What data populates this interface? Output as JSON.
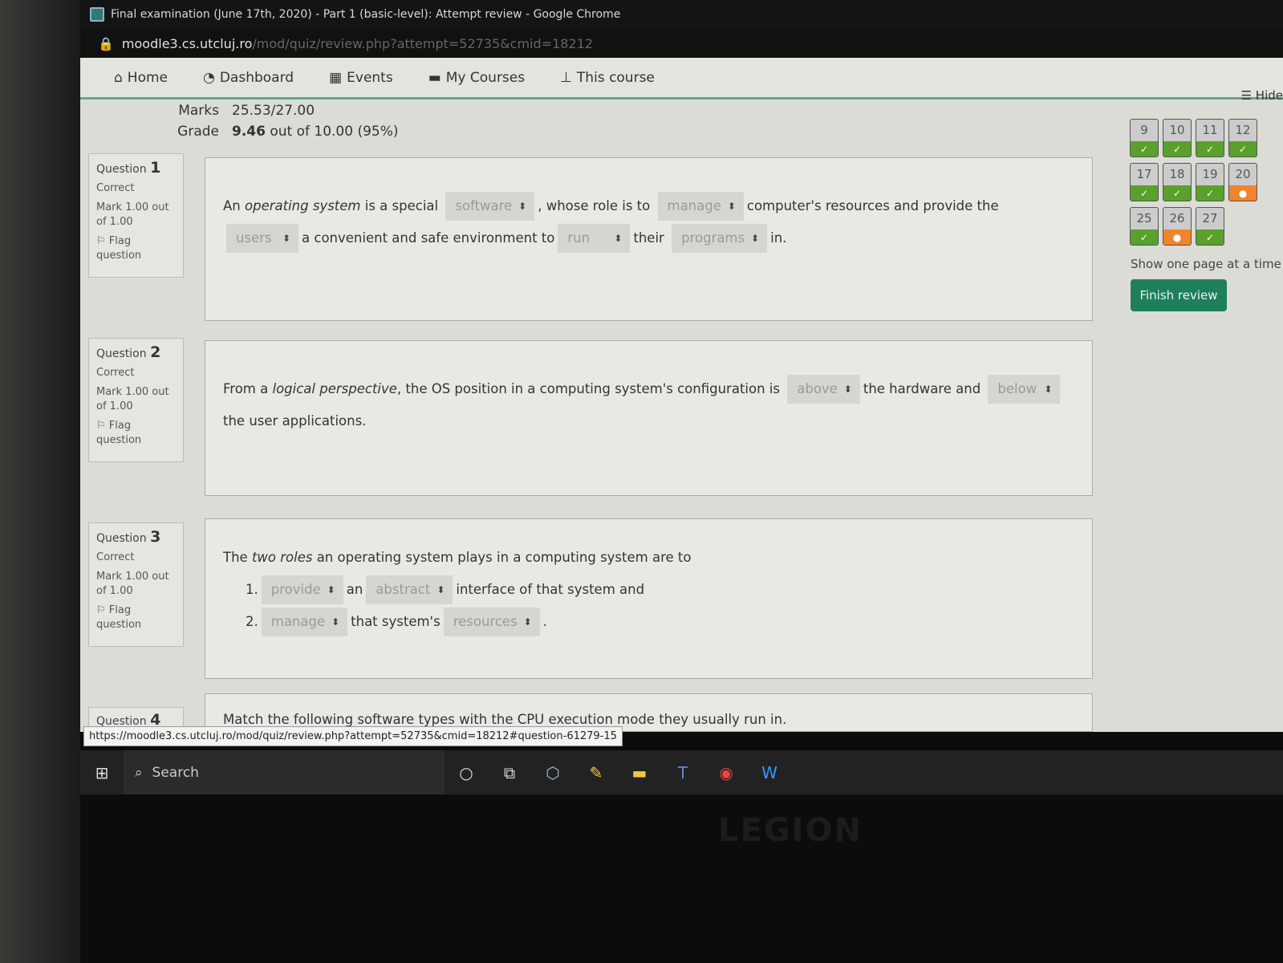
{
  "browser": {
    "title": "Final examination (June 17th, 2020) - Part 1 (basic-level): Attempt review - Google Chrome",
    "url_host": "moodle3.cs.utcluj.ro",
    "url_path": "/mod/quiz/review.php?attempt=52735&cmid=18212"
  },
  "nav": {
    "items": [
      {
        "label": "Home",
        "icon": "home-icon"
      },
      {
        "label": "Dashboard",
        "icon": "dashboard-icon"
      },
      {
        "label": "Events",
        "icon": "calendar-icon"
      },
      {
        "label": "My Courses",
        "icon": "briefcase-icon"
      },
      {
        "label": "This course",
        "icon": "sitemap-icon"
      }
    ],
    "hide": "Hide"
  },
  "summary": {
    "marks_label": "Marks",
    "marks": "25.53/27.00",
    "grade_label": "Grade",
    "grade_value": "9.46",
    "grade_rest": " out of 10.00 (95%)"
  },
  "questions": [
    {
      "label": "Question",
      "num": "1",
      "state": "Correct",
      "mark": "Mark 1.00 out of 1.00",
      "flag": "Flag question"
    },
    {
      "label": "Question",
      "num": "2",
      "state": "Correct",
      "mark": "Mark 1.00 out of 1.00",
      "flag": "Flag question"
    },
    {
      "label": "Question",
      "num": "3",
      "state": "Correct",
      "mark": "Mark 1.00 out of 1.00",
      "flag": "Flag question"
    },
    {
      "label": "Question",
      "num": "4"
    }
  ],
  "q1": {
    "t1": "An ",
    "t2": "operating system",
    "t3": " is a special",
    "s1": "software",
    "t4": ", whose role is to",
    "s2": "manage",
    "t5": "computer's resources and provide the",
    "s3": "users",
    "t6": "a",
    "t7": "convenient and safe environment to",
    "s4": "run",
    "t8": "their",
    "s5": "programs",
    "t9": "in."
  },
  "q2": {
    "t1": "From a ",
    "t2": "logical perspective",
    "t3": ", the OS position in a computing system's configuration is",
    "s1": "above",
    "t4": "the hardware and",
    "s2": "below",
    "t5": "the user",
    "t6": "applications."
  },
  "q3": {
    "t1": "The ",
    "t2": "two roles",
    "t3": " an operating system plays in a computing system are to",
    "n1": "1.",
    "s1": "provide",
    "a1": "an",
    "s2": "abstract",
    "a2": "interface of that system and",
    "n2": "2.",
    "s3": "manage",
    "a3": "that system's",
    "s4": "resources",
    "a4": "."
  },
  "q4": {
    "text": "Match the following software types with the CPU execution mode they usually run in."
  },
  "quiz_nav": {
    "buttons": [
      {
        "n": "9",
        "s": "correct"
      },
      {
        "n": "10",
        "s": "correct"
      },
      {
        "n": "11",
        "s": "correct"
      },
      {
        "n": "12",
        "s": "correct"
      },
      {
        "n": "17",
        "s": "correct"
      },
      {
        "n": "18",
        "s": "correct"
      },
      {
        "n": "19",
        "s": "correct"
      },
      {
        "n": "20",
        "s": "partial"
      },
      {
        "n": "25",
        "s": "correct"
      },
      {
        "n": "26",
        "s": "partial"
      },
      {
        "n": "27",
        "s": "correct"
      }
    ],
    "show_one_page": "Show one page at a time",
    "finish": "Finish review",
    "colors": {
      "correct": "#5aa02c",
      "partial": "#f0842c"
    }
  },
  "status_url": "https://moodle3.cs.utcluj.ro/mod/quiz/review.php?attempt=52735&cmid=18212#question-61279-15",
  "taskbar": {
    "search": "Search"
  },
  "bezel_logo": "LEGION"
}
